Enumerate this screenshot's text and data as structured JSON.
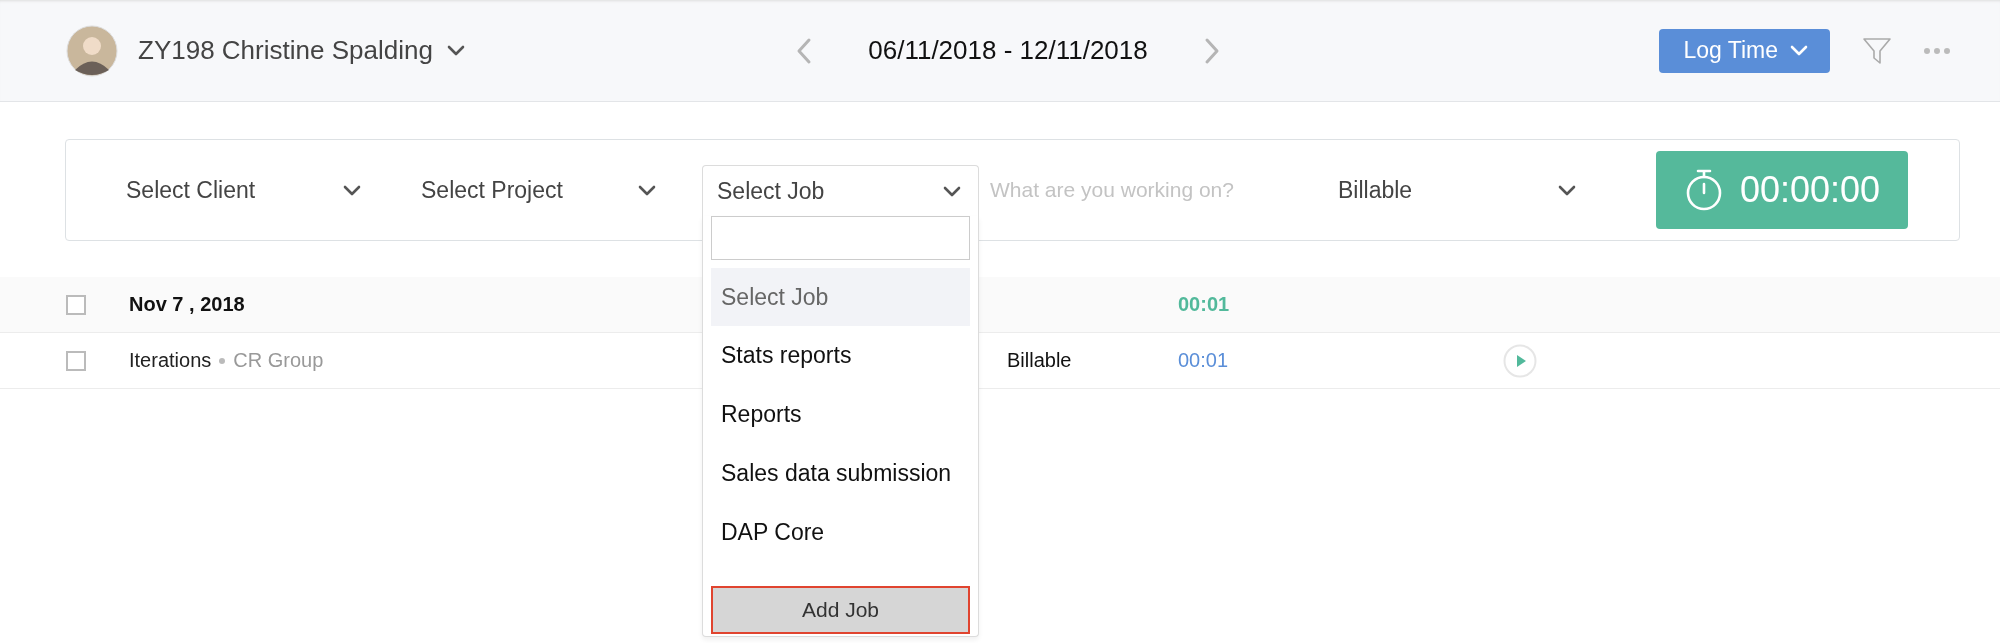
{
  "header": {
    "user": {
      "name": "ZY198 Christine Spalding"
    },
    "date_range": "06/11/2018 - 12/11/2018",
    "log_time_button": "Log Time"
  },
  "entry_bar": {
    "client_select": "Select Client",
    "project_select": "Select Project",
    "job_select": {
      "value": "Select Job",
      "expanded": true
    },
    "description": {
      "placeholder": "What are you working on?"
    },
    "billing_select": "Billable",
    "timer": "00:00:00"
  },
  "job_dropdown": {
    "options": [
      {
        "label": "Select Job",
        "selected": true
      },
      {
        "label": "Stats reports",
        "selected": false
      },
      {
        "label": "Reports",
        "selected": false
      },
      {
        "label": "Sales data submission",
        "selected": false
      },
      {
        "label": "DAP Core",
        "selected": false
      }
    ],
    "add_button": "Add Job"
  },
  "log": {
    "groups": [
      {
        "date": "Nov 7 , 2018",
        "checked": false,
        "total": "00:01",
        "entries": [
          {
            "job": "Iterations",
            "project": "CR Group",
            "billing": "Billable",
            "duration": "00:01",
            "checked": false
          }
        ]
      }
    ]
  }
}
